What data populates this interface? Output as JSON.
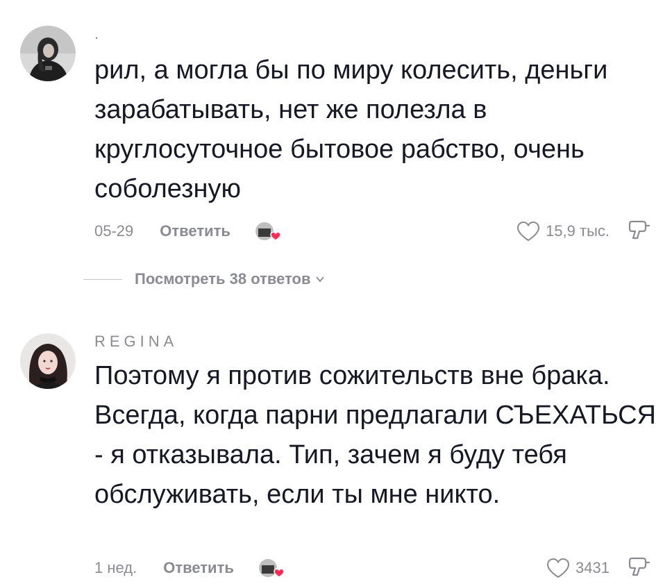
{
  "comments": [
    {
      "username": ".",
      "text": "рил, а могла бы по миру колесить, деньги зарабатывать, нет же полезла в круглосуточное бытовое рабство, очень соболезную",
      "date": "05-29",
      "reply_label": "Ответить",
      "like_count": "15,9 тыс.",
      "view_replies_label": "Посмотреть 38 ответов"
    },
    {
      "username": "REGINA",
      "text": "Поэтому я против сожительств вне брака. Всегда, когда парни предлагали СЪЕХАТЬСЯ - я отказывала. Тип, зачем я буду тебя обслуживать, если ты мне никто.",
      "date": "1 нед.",
      "reply_label": "Ответить",
      "like_count": "3431"
    }
  ],
  "colors": {
    "text": "#161823",
    "secondary": "#8a8b91",
    "heart_badge": "#fe2c55"
  },
  "icons": [
    "heart-outline-icon",
    "dislike-icon",
    "chevron-down-icon",
    "creator-liked-icon"
  ]
}
